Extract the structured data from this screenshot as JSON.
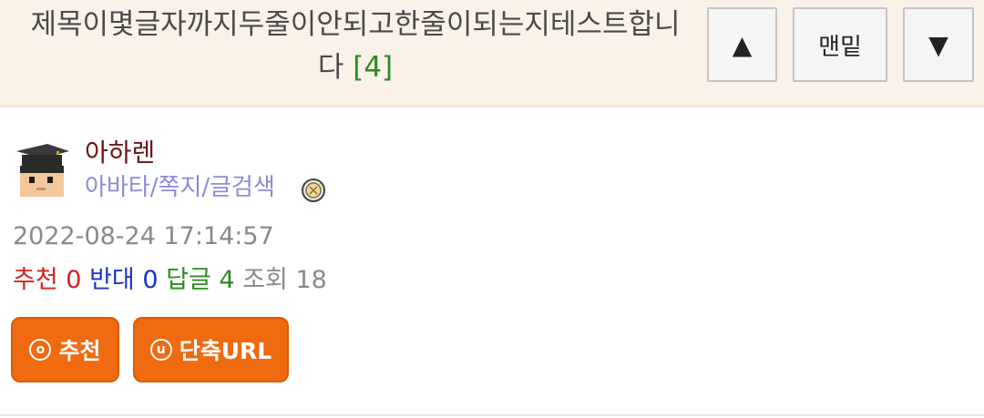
{
  "header": {
    "title": "제목이몇글자까지두줄이안되고한줄이되는지테스트합니다",
    "reply_count": "[4]"
  },
  "nav": {
    "up_label": "▲",
    "bottom_label": "맨밑",
    "down_label": "▼"
  },
  "author": {
    "name": "아하렌",
    "links": "아바타/쪽지/글검색",
    "avatar_icon": "student-avatar-icon",
    "level_icon": "level-badge-icon"
  },
  "post": {
    "datetime": "2022-08-24 17:14:57"
  },
  "stats": {
    "recommend_label": "추천",
    "recommend_value": "0",
    "oppose_label": "반대",
    "oppose_value": "0",
    "reply_label": "답글",
    "reply_value": "4",
    "views_label": "조회",
    "views_value": "18"
  },
  "actions": {
    "recommend_label": "추천",
    "recommend_icon_glyph": "o",
    "shorturl_label": "단축URL",
    "shorturl_icon_glyph": "u"
  },
  "colors": {
    "header_bg": "#faf1e8",
    "author_name": "#6b1515",
    "link": "#8b8bd9",
    "red": "#d42020",
    "blue": "#1c33c8",
    "green": "#2e8b22",
    "button": "#f06a10"
  }
}
